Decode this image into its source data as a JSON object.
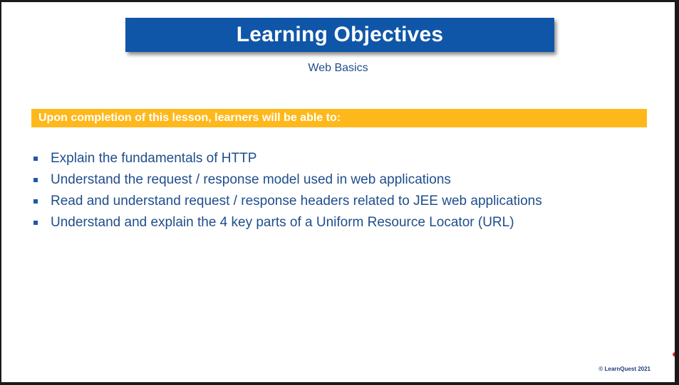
{
  "slide": {
    "title": "Learning Objectives",
    "subtitle": "Web Basics",
    "banner": "Upon completion of this lesson, learners will be able to:",
    "objectives": [
      "Explain the fundamentals of HTTP",
      "Understand the request / response model used in web applications",
      "Read and understand request / response headers related to JEE web applications",
      "Understand and explain the 4 key parts of a Uniform Resource Locator (URL)"
    ],
    "copyright": "© LearnQuest 2021"
  },
  "colors": {
    "title_bar": "#0f56a8",
    "banner": "#ffb81c",
    "text_blue": "#1f4e8c"
  }
}
